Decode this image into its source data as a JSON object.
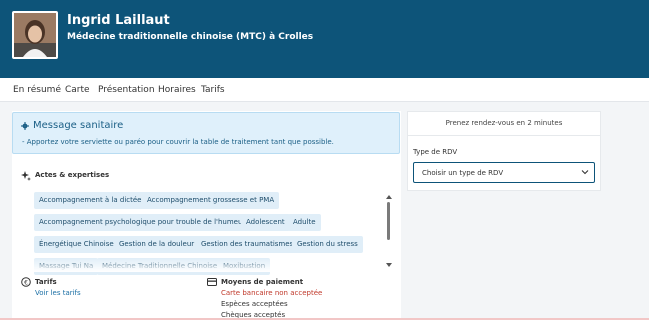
{
  "header": {
    "name": "Ingrid Laillaut",
    "specialty": "Médecine traditionnelle chinoise (MTC) à Crolles"
  },
  "nav": {
    "items": [
      {
        "label": "En résumé"
      },
      {
        "label": "Carte"
      },
      {
        "label": "Présentation"
      },
      {
        "label": "Horaires"
      },
      {
        "label": "Tarifs"
      }
    ]
  },
  "alert": {
    "title": "Message sanitaire",
    "text": "- Apportez votre serviette ou paréo pour couvrir la table de traitement tant que possible."
  },
  "expertises": {
    "title": "Actes & expertises",
    "tags": [
      "Accompagnement à la dictée",
      "Accompagnement grossesse et PMA",
      "Accompagnement psychologique pour trouble de l'humeur",
      "Adolescent",
      "Adulte",
      "Énergétique Chinoise",
      "Gestion de la douleur",
      "Gestion des traumatismes",
      "Gestion du stress",
      "Massage Tui Na",
      "Médecine Traditionnelle Chinoise",
      "Moxibustion"
    ]
  },
  "tarifs": {
    "title": "Tarifs",
    "link": "Voir les tarifs"
  },
  "paiement": {
    "title": "Moyens de paiement",
    "items": [
      "Carte bancaire non acceptée",
      "Espèces acceptées",
      "Chèques acceptés"
    ]
  },
  "booking": {
    "title": "Prenez rendez-vous en 2 minutes",
    "type_label": "Type de RDV",
    "select_value": "Choisir un type de RDV"
  },
  "colors": {
    "brand": "#0d5479",
    "alert_bg": "#dff0fb",
    "tag_bg": "#e0eef8",
    "link": "#1b6fa5",
    "danger": "#c0392b"
  }
}
